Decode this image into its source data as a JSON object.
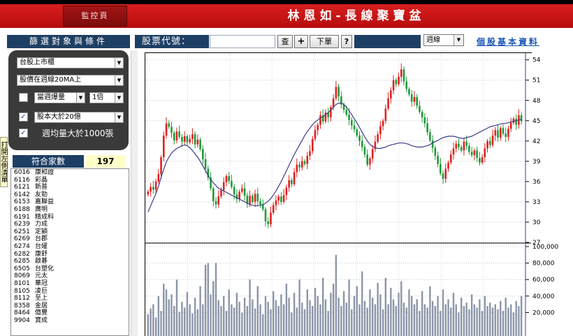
{
  "header": {
    "monitor_label": "監控頁",
    "title": "林恩如-長線聚寶盆"
  },
  "toolbar": {
    "filter_title": "篩選對象與條件",
    "stock_code_label": "股票代號：",
    "stock_code_value": "",
    "search_label": "查",
    "add_label": "+",
    "order_label": "下單",
    "help_label": "?",
    "stock_name": "",
    "period": "週線",
    "basic_info": "個股基本資料"
  },
  "filters": {
    "market": "台股上市櫃",
    "price_condition": "股價在週線20MA上",
    "weekly_volume": {
      "checked": false,
      "label": "當週爆量",
      "multiple": "1倍"
    },
    "capital": {
      "checked": true,
      "label": "股本大於20億"
    },
    "avg_volume": {
      "checked": true,
      "label": "週均量大於1000張"
    }
  },
  "side_tab": "打開左側清單",
  "count": {
    "label": "符合家數",
    "value": "197"
  },
  "stock_list": [
    {
      "code": "6016",
      "name": "康和證"
    },
    {
      "code": "6116",
      "name": "彩晶"
    },
    {
      "code": "6121",
      "name": "新普"
    },
    {
      "code": "6142",
      "name": "友勁"
    },
    {
      "code": "6153",
      "name": "嘉聯益"
    },
    {
      "code": "6188",
      "name": "廣明"
    },
    {
      "code": "6191",
      "name": "精成科"
    },
    {
      "code": "6239",
      "name": "力成"
    },
    {
      "code": "6251",
      "name": "定穎"
    },
    {
      "code": "6269",
      "name": "台郡"
    },
    {
      "code": "6274",
      "name": "台燿"
    },
    {
      "code": "6282",
      "name": "康舒"
    },
    {
      "code": "6285",
      "name": "啟碁"
    },
    {
      "code": "6505",
      "name": "台塑化"
    },
    {
      "code": "8069",
      "name": "元太"
    },
    {
      "code": "8101",
      "name": "華冠"
    },
    {
      "code": "8105",
      "name": "凌巨"
    },
    {
      "code": "8112",
      "name": "至上"
    },
    {
      "code": "8358",
      "name": "金居"
    },
    {
      "code": "8464",
      "name": "億豐"
    },
    {
      "code": "9904",
      "name": "寶成"
    }
  ],
  "chart_data": {
    "type": "candlestick",
    "price_axis": {
      "ticks": [
        "54",
        "51",
        "48",
        "45",
        "42",
        "39",
        "36",
        "33",
        "30",
        "27"
      ],
      "range": [
        27,
        55
      ]
    },
    "volume_axis": {
      "ticks": [
        "100,000",
        "80,000",
        "60,000",
        "40,000",
        "20,000"
      ],
      "range": [
        0,
        100000
      ]
    },
    "ma_color": "#3c3c8c",
    "up_color": "#e02020",
    "down_color": "#1f9a3a",
    "volume_color": "#8c96a8",
    "closes": [
      34.5,
      35.2,
      34.8,
      36.0,
      37.1,
      39.6,
      42.8,
      44.6,
      44.1,
      43.2,
      42.1,
      43.4,
      42.6,
      41.9,
      42.7,
      41.8,
      42.3,
      43.0,
      41.5,
      42.2,
      40.8,
      39.3,
      37.9,
      36.6,
      35.0,
      33.1,
      32.6,
      33.8,
      34.7,
      35.9,
      36.8,
      36.1,
      35.2,
      34.1,
      33.4,
      34.5,
      35.0,
      33.9,
      32.7,
      33.9,
      33.0,
      34.2,
      33.1,
      32.6,
      31.9,
      30.1,
      29.7,
      31.4,
      32.5,
      33.2,
      33.8,
      33.0,
      34.0,
      35.1,
      36.2,
      35.6,
      37.4,
      38.5,
      38.1,
      39.0,
      38.6,
      39.8,
      40.5,
      42.3,
      43.6,
      44.4,
      45.8,
      44.9,
      46.2,
      45.5,
      47.0,
      48.3,
      50.0,
      48.6,
      47.4,
      46.6,
      45.9,
      45.1,
      44.3,
      43.7,
      42.8,
      42.0,
      41.1,
      40.0,
      38.5,
      39.4,
      40.8,
      41.9,
      43.0,
      44.2,
      45.0,
      46.8,
      48.3,
      49.5,
      51.0,
      50.4,
      51.5,
      52.6,
      50.8,
      49.7,
      48.9,
      47.8,
      48.5,
      47.2,
      46.3,
      45.5,
      44.6,
      43.3,
      42.1,
      41.0,
      39.8,
      38.6,
      37.2,
      36.4,
      37.9,
      38.8,
      40.0,
      40.9,
      41.6,
      41.1,
      40.6,
      41.9,
      41.3,
      40.4,
      39.9,
      40.6,
      39.5,
      38.8,
      39.6,
      40.9,
      42.0,
      41.4,
      42.8,
      43.6,
      42.5,
      43.9,
      43.1,
      42.6,
      43.8,
      44.7,
      45.3,
      44.4,
      45.8,
      44.9
    ],
    "ma": [
      31.5,
      32.4,
      33.3,
      34.2,
      35.3,
      36.6,
      37.8,
      38.9,
      39.6,
      40.2,
      40.6,
      40.9,
      41.1,
      41.3,
      41.4,
      41.3,
      41.0,
      40.6,
      40.1,
      39.6,
      39.0,
      38.3,
      37.6,
      36.9,
      36.3,
      35.8,
      35.4,
      35.0,
      34.8,
      34.6,
      34.4,
      34.2,
      34.0,
      33.8,
      33.6,
      33.4,
      33.2,
      33.0,
      32.8,
      32.6,
      32.5,
      32.4,
      32.4,
      32.5,
      32.6,
      32.8,
      33.1,
      33.5,
      34.0,
      34.6,
      35.3,
      36.0,
      36.8,
      37.6,
      38.4,
      39.2,
      40.0,
      40.7,
      41.4,
      42.1,
      42.8,
      43.4,
      43.9,
      44.4,
      44.8,
      45.1,
      45.4,
      45.6,
      45.9,
      46.2,
      46.6,
      47.0,
      47.4,
      47.6,
      47.6,
      47.4,
      47.0,
      46.5,
      45.9,
      45.3,
      44.7,
      44.0,
      43.3,
      42.6,
      42.0,
      41.5,
      41.2,
      41.0,
      40.9,
      40.9,
      41.0,
      41.1,
      41.3,
      41.4,
      41.5,
      41.6,
      41.7,
      41.7,
      41.7,
      41.6,
      41.5,
      41.3,
      41.2,
      41.1,
      41.1,
      41.1,
      41.2,
      41.3,
      41.5,
      41.7,
      41.9,
      42.1,
      42.3,
      42.5,
      42.6,
      42.7,
      42.7,
      42.7,
      42.6,
      42.5,
      42.4,
      42.4,
      42.5,
      42.6,
      42.7,
      42.9,
      43.1,
      43.3,
      43.5,
      43.7,
      43.9,
      44.1,
      44.2,
      44.3,
      44.4,
      44.5,
      44.6,
      44.6,
      44.7,
      44.8,
      44.9,
      45.0,
      45.1,
      45.2
    ],
    "volumes": [
      18000,
      25000,
      30000,
      14000,
      40000,
      22000,
      55000,
      48000,
      36000,
      42000,
      28000,
      60000,
      21000,
      33000,
      26000,
      45000,
      30000,
      19000,
      38000,
      24000,
      52000,
      30000,
      78000,
      80000,
      42000,
      58000,
      80000,
      35000,
      28000,
      40000,
      22000,
      48000,
      30000,
      26000,
      44000,
      33000,
      20000,
      38000,
      28000,
      60000,
      36000,
      25000,
      52000,
      30000,
      18000,
      40000,
      33000,
      24000,
      46000,
      35000,
      28000,
      42000,
      30000,
      55000,
      38000,
      20000,
      44000,
      26000,
      60000,
      32000,
      24000,
      48000,
      35000,
      28000,
      50000,
      40000,
      30000,
      62000,
      36000,
      22000,
      44000,
      55000,
      90000,
      38000,
      28000,
      46000,
      32000,
      60000,
      24000,
      40000,
      52000,
      30000,
      70000,
      34000,
      26000,
      48000,
      38000,
      30000,
      56000,
      42000,
      24000,
      62000,
      30000,
      50000,
      36000,
      28000,
      44000,
      58000,
      32000,
      26000,
      48000,
      40000,
      30000,
      36000,
      22000,
      46000,
      30000,
      26000,
      52000,
      34000,
      28000,
      40000,
      22000,
      48000,
      30000,
      36000,
      26000,
      44000,
      30000,
      20000,
      38000,
      28000,
      32000,
      24000,
      42000,
      30000,
      26000,
      36000,
      22000,
      40000,
      28000,
      32000,
      26000,
      30000,
      24000,
      34000,
      22000,
      38000,
      26000,
      30000,
      20000,
      34000,
      28000,
      40000
    ]
  }
}
